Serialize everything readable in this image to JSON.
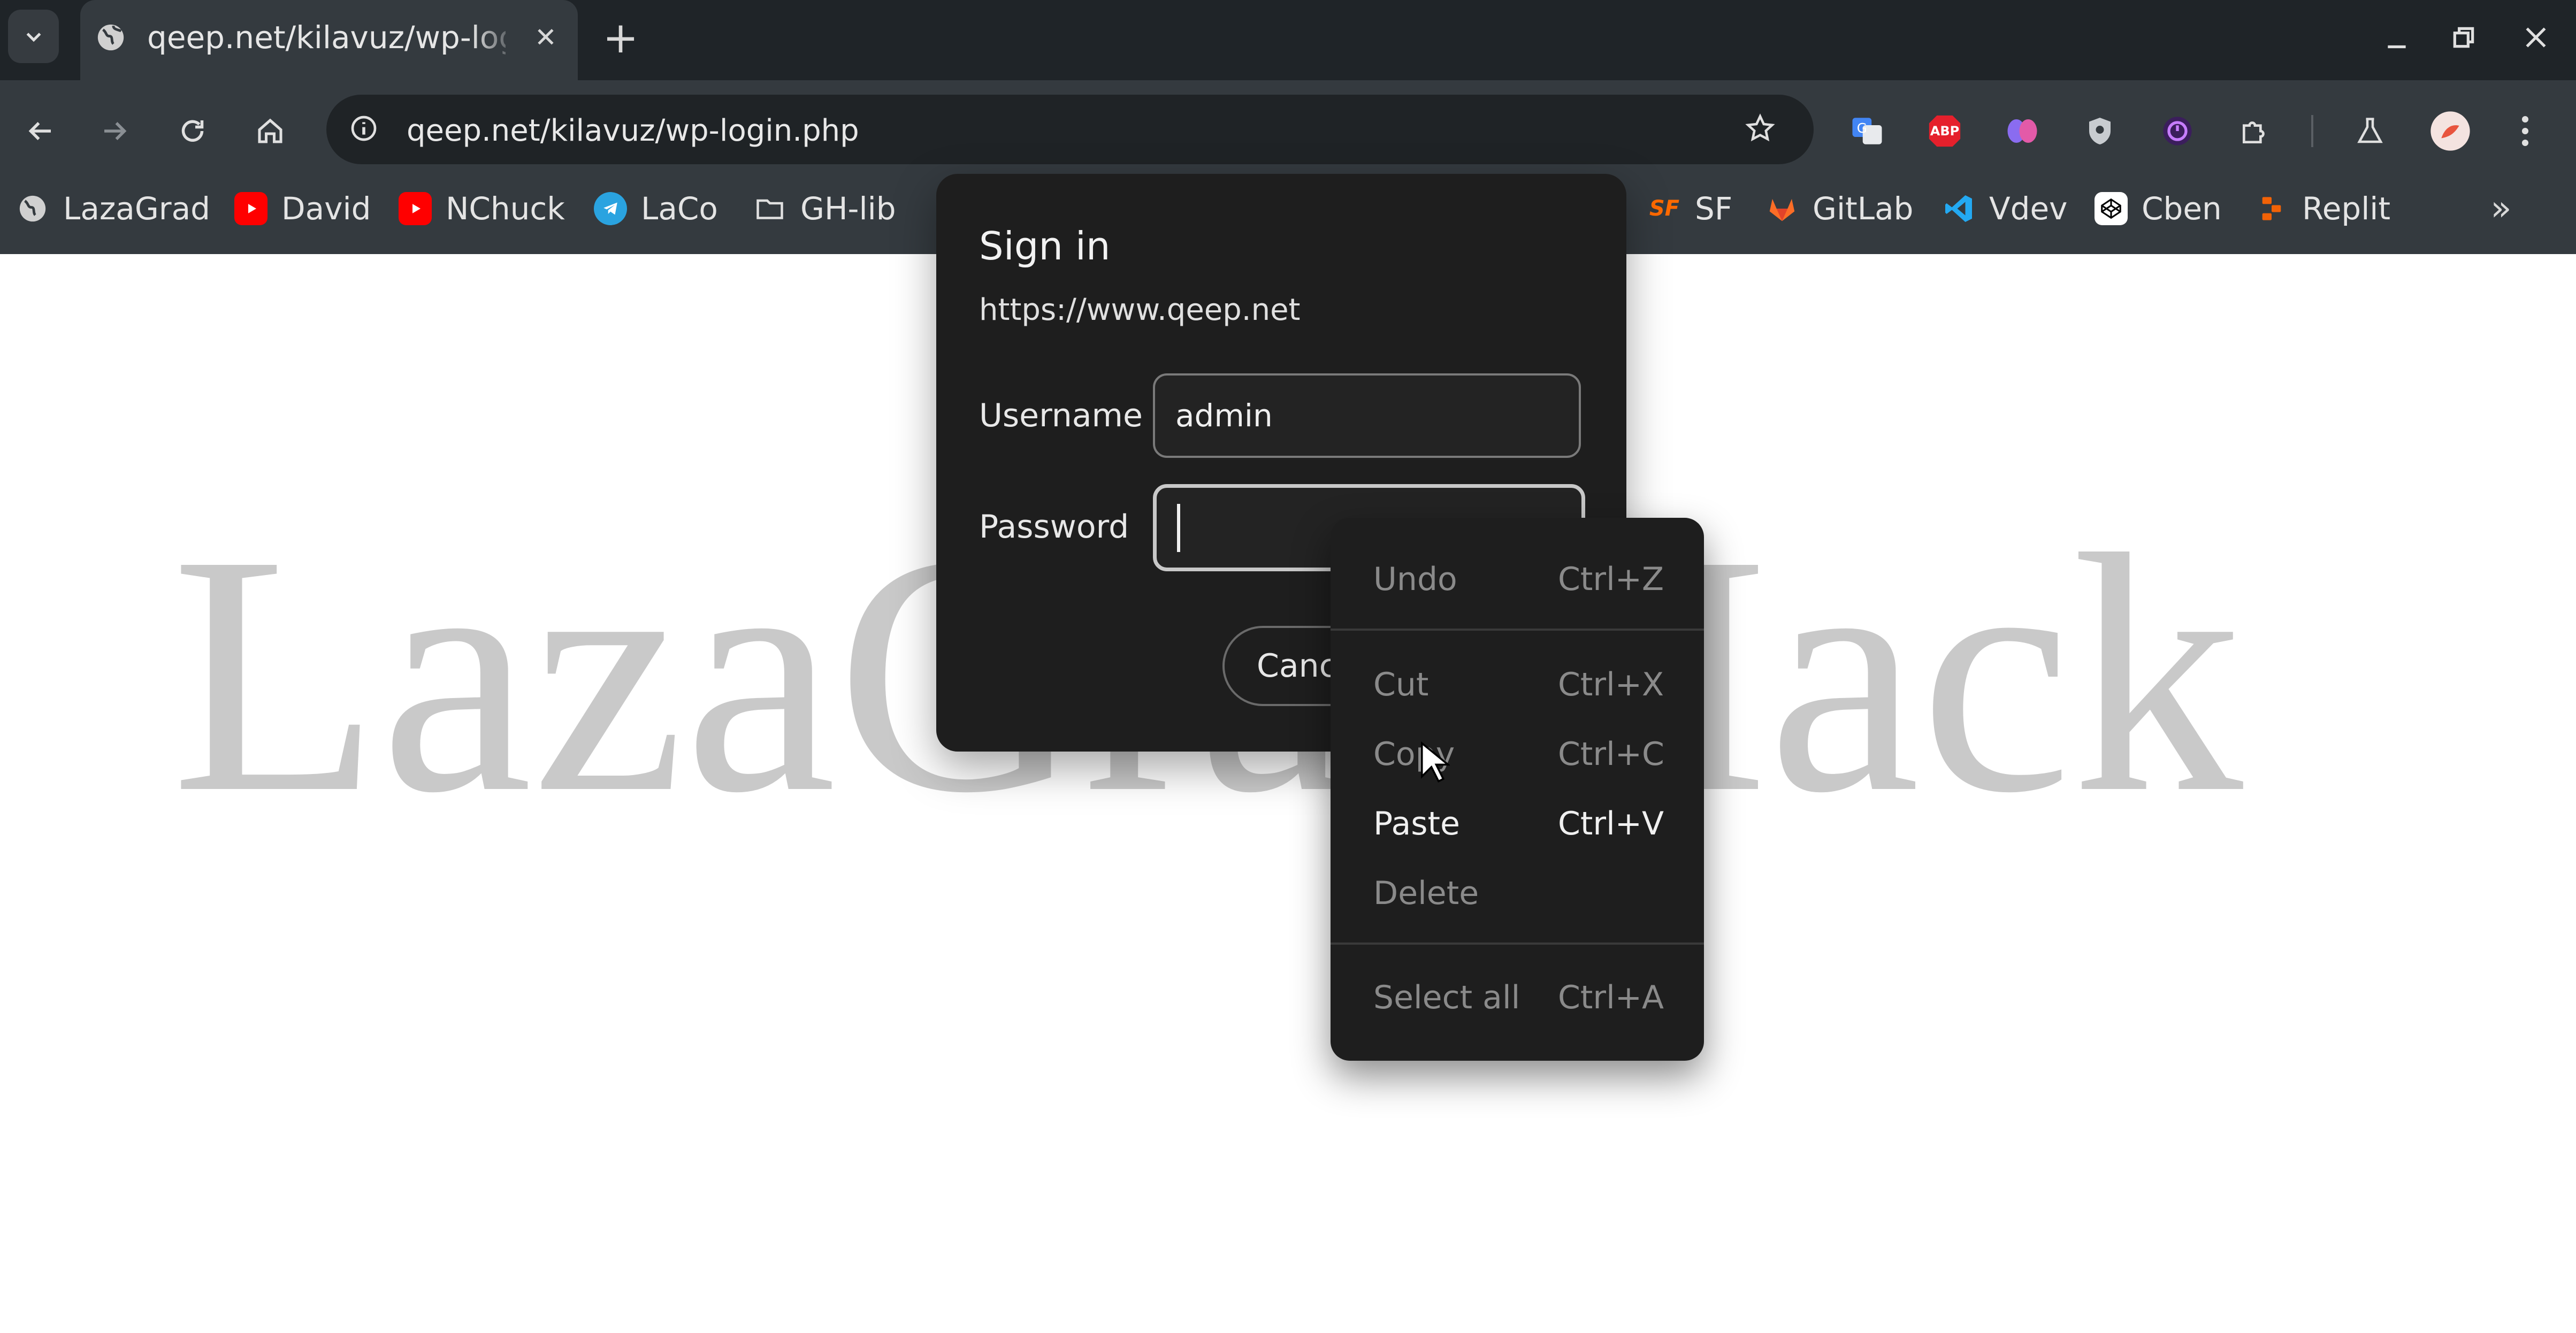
{
  "browser": {
    "tab": {
      "title": "qeep.net/kilavuz/wp-login.php",
      "favicon": "globe-icon",
      "close_glyph": "✕"
    },
    "new_tab_glyph": "+",
    "window_controls": [
      "minimize-icon",
      "restore-icon",
      "close-icon"
    ],
    "address_bar": {
      "url": "qeep.net/kilavuz/wp-login.php"
    },
    "bookmarks": [
      {
        "label": "LazaGrad",
        "icon": "globe-icon"
      },
      {
        "label": "David",
        "icon": "youtube-icon"
      },
      {
        "label": "NChuck",
        "icon": "youtube-icon"
      },
      {
        "label": "LaCo",
        "icon": "telegram-icon"
      },
      {
        "label": "GH-lib",
        "icon": "folder-icon"
      },
      {
        "label": "SF",
        "icon": "sf-icon"
      },
      {
        "label": "GitLab",
        "icon": "gitlab-icon"
      },
      {
        "label": "Vdev",
        "icon": "vscode-icon"
      },
      {
        "label": "Cben",
        "icon": "codepen-icon"
      },
      {
        "label": "Replit",
        "icon": "replit-icon"
      }
    ],
    "bookmarks_overflow_glyph": "»",
    "extensions": [
      "google-translate-icon",
      "adblock-icon",
      "brain-icon",
      "shield-icon",
      "timer-icon",
      "puzzle-icon",
      "flask-icon",
      "profile-avatar",
      "more-menu-icon"
    ],
    "extension_labels": {
      "adblock": "ABP"
    }
  },
  "page": {
    "watermark": "LazaGradHack"
  },
  "dialog": {
    "title": "Sign in",
    "origin": "https://www.qeep.net",
    "username_label": "Username",
    "username_value": "admin",
    "password_label": "Password",
    "password_value": "",
    "cancel_label": "Cancel"
  },
  "context_menu": {
    "items": [
      {
        "label": "Undo",
        "shortcut": "Ctrl+Z",
        "enabled": false
      },
      {
        "label": "Cut",
        "shortcut": "Ctrl+X",
        "enabled": false
      },
      {
        "label": "Copy",
        "shortcut": "Ctrl+C",
        "enabled": false
      },
      {
        "label": "Paste",
        "shortcut": "Ctrl+V",
        "enabled": true
      },
      {
        "label": "Delete",
        "shortcut": "",
        "enabled": false
      },
      {
        "label": "Select all",
        "shortcut": "Ctrl+A",
        "enabled": false
      }
    ]
  },
  "colors": {
    "chrome_dark": "#1f2428",
    "toolbar": "#343a3f",
    "dialog_bg": "#1e1e1e",
    "watermark": "#c9c9c9"
  }
}
